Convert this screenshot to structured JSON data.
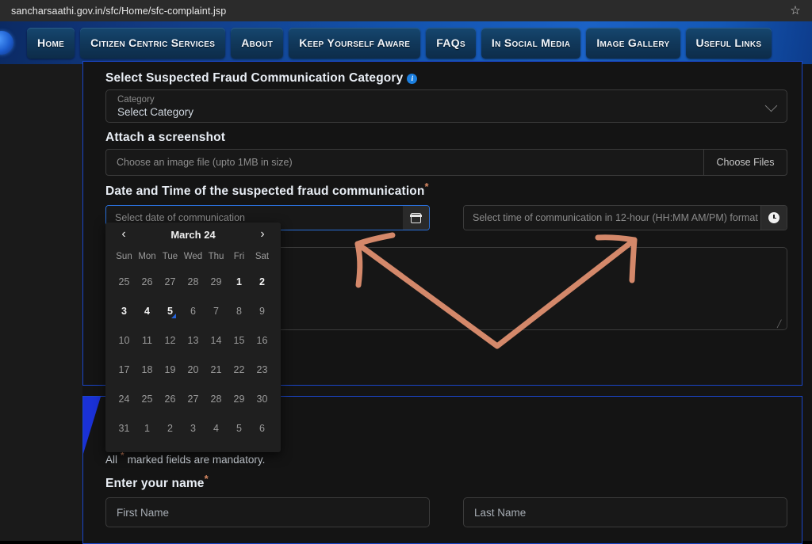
{
  "browser": {
    "url": "sancharsaathi.gov.in/sfc/Home/sfc-complaint.jsp",
    "bookmark_icon": "star-icon",
    "bookmark_glyph": "☆"
  },
  "nav": {
    "logo_icon": "site-logo-icon",
    "items": [
      {
        "label": "Home"
      },
      {
        "label": "Citizen Centric Services"
      },
      {
        "label": "About"
      },
      {
        "label": "Keep Yourself Aware"
      },
      {
        "label": "FAQs"
      },
      {
        "label": "In Social Media"
      },
      {
        "label": "Image Gallery"
      },
      {
        "label": "Useful Links"
      }
    ]
  },
  "form": {
    "category": {
      "label": "Select Suspected Fraud Communication Category",
      "info_icon": "info-icon",
      "info_glyph": "i",
      "mini_label": "Category",
      "value": "Select Category",
      "chevron_icon": "chevron-down-icon"
    },
    "attachment": {
      "label": "Attach a screenshot",
      "placeholder": "Choose an image file (upto 1MB in size)",
      "button_label": "Choose Files"
    },
    "datetime": {
      "label": "Date and Time of the suspected fraud communication",
      "required_marker": "*",
      "date_placeholder": "Select date of communication",
      "date_icon": "calendar-icon",
      "time_placeholder": "Select time of communication in 12-hour (HH:MM AM/PM) format",
      "time_icon": "clock-icon"
    },
    "description": {
      "value": "",
      "resize_handle_glyph": "╱"
    },
    "mandatory_note_prefix": "All ",
    "mandatory_note_marker": "*",
    "mandatory_note_suffix": " marked fields are mandatory.",
    "name": {
      "label": "Enter your name",
      "required_marker": "*",
      "first_placeholder": "First Name",
      "last_placeholder": "Last Name"
    }
  },
  "calendar": {
    "prev_icon": "chevron-left-icon",
    "prev_glyph": "‹",
    "next_icon": "chevron-right-icon",
    "next_glyph": "›",
    "title": "March 24",
    "dows": [
      "Sun",
      "Mon",
      "Tue",
      "Wed",
      "Thu",
      "Fri",
      "Sat"
    ],
    "weeks": [
      [
        {
          "n": "25",
          "cur": false,
          "today": false
        },
        {
          "n": "26",
          "cur": false,
          "today": false
        },
        {
          "n": "27",
          "cur": false,
          "today": false
        },
        {
          "n": "28",
          "cur": false,
          "today": false
        },
        {
          "n": "29",
          "cur": false,
          "today": false
        },
        {
          "n": "1",
          "cur": true,
          "today": false
        },
        {
          "n": "2",
          "cur": true,
          "today": false
        }
      ],
      [
        {
          "n": "3",
          "cur": true,
          "today": false
        },
        {
          "n": "4",
          "cur": true,
          "today": false
        },
        {
          "n": "5",
          "cur": true,
          "today": true
        },
        {
          "n": "6",
          "cur": false,
          "today": false
        },
        {
          "n": "7",
          "cur": false,
          "today": false
        },
        {
          "n": "8",
          "cur": false,
          "today": false
        },
        {
          "n": "9",
          "cur": false,
          "today": false
        }
      ],
      [
        {
          "n": "10",
          "cur": false,
          "today": false
        },
        {
          "n": "11",
          "cur": false,
          "today": false
        },
        {
          "n": "12",
          "cur": false,
          "today": false
        },
        {
          "n": "13",
          "cur": false,
          "today": false
        },
        {
          "n": "14",
          "cur": false,
          "today": false
        },
        {
          "n": "15",
          "cur": false,
          "today": false
        },
        {
          "n": "16",
          "cur": false,
          "today": false
        }
      ],
      [
        {
          "n": "17",
          "cur": false,
          "today": false
        },
        {
          "n": "18",
          "cur": false,
          "today": false
        },
        {
          "n": "19",
          "cur": false,
          "today": false
        },
        {
          "n": "20",
          "cur": false,
          "today": false
        },
        {
          "n": "21",
          "cur": false,
          "today": false
        },
        {
          "n": "22",
          "cur": false,
          "today": false
        },
        {
          "n": "23",
          "cur": false,
          "today": false
        }
      ],
      [
        {
          "n": "24",
          "cur": false,
          "today": false
        },
        {
          "n": "25",
          "cur": false,
          "today": false
        },
        {
          "n": "26",
          "cur": false,
          "today": false
        },
        {
          "n": "27",
          "cur": false,
          "today": false
        },
        {
          "n": "28",
          "cur": false,
          "today": false
        },
        {
          "n": "29",
          "cur": false,
          "today": false
        },
        {
          "n": "30",
          "cur": false,
          "today": false
        }
      ],
      [
        {
          "n": "31",
          "cur": false,
          "today": false
        },
        {
          "n": "1",
          "cur": false,
          "today": false
        },
        {
          "n": "2",
          "cur": false,
          "today": false
        },
        {
          "n": "3",
          "cur": false,
          "today": false
        },
        {
          "n": "4",
          "cur": false,
          "today": false
        },
        {
          "n": "5",
          "cur": false,
          "today": false
        },
        {
          "n": "6",
          "cur": false,
          "today": false
        }
      ]
    ]
  },
  "annotation": {
    "shape": "double-headed-v-arrow",
    "color": "#d4886a"
  },
  "colors": {
    "accent_blue": "#1a45c8",
    "nav_blue": "#1353ad",
    "focus_blue": "#2a6fd8",
    "required_orange": "#d98963",
    "annotation": "#d4886a"
  }
}
